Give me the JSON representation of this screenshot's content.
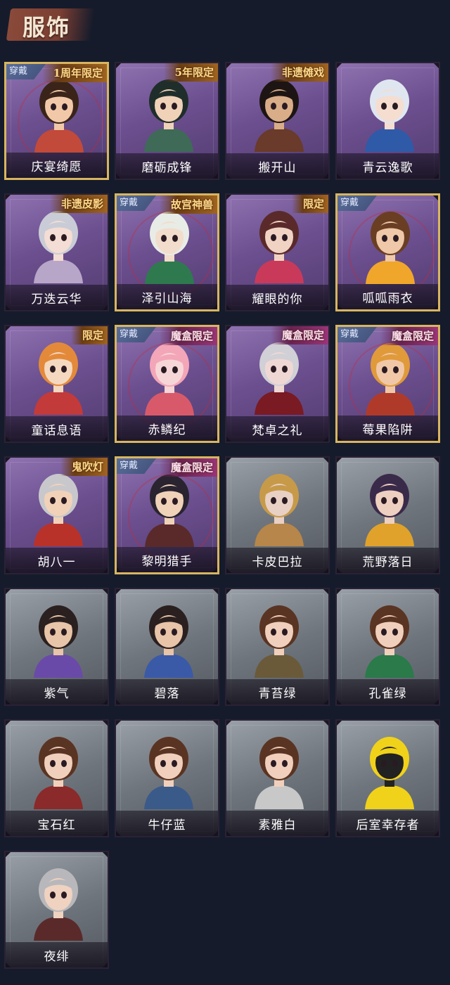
{
  "header": {
    "title": "服饰"
  },
  "equip_text": "穿戴",
  "colors": {
    "purple_card": "#6c4f8f",
    "gray_card": "#6f757d",
    "background": "#151b2b",
    "gold_border": "#d8b560"
  },
  "items": [
    {
      "name": "庆宴绮愿",
      "tag": "1周年限定",
      "equipped": true,
      "style": "purple",
      "skin": "#f2c9a8",
      "hair": "#3a241a",
      "outfit": "#c24a3a"
    },
    {
      "name": "磨砺成锋",
      "tag": "5年限定",
      "equipped": false,
      "style": "purple",
      "skin": "#f0d2b8",
      "hair": "#1f2e2a",
      "outfit": "#3f6a58"
    },
    {
      "name": "搬开山",
      "tag": "非遗傩戏",
      "equipped": false,
      "style": "purple",
      "skin": "#d9ad88",
      "hair": "#1d1513",
      "outfit": "#6a3a2a"
    },
    {
      "name": "青云逸歌",
      "tag": "",
      "equipped": false,
      "style": "purple",
      "skin": "#f5ddd0",
      "hair": "#dfe6f0",
      "outfit": "#2f5aa8"
    },
    {
      "name": "万迭云华",
      "tag": "非遗皮影",
      "equipped": false,
      "style": "purple",
      "skin": "#f3ddd4",
      "hair": "#c9ccd6",
      "outfit": "#b8a6c8"
    },
    {
      "name": "泽引山海",
      "tag": "故宫神兽",
      "equipped": true,
      "style": "purple",
      "skin": "#f2dccb",
      "hair": "#e8ece6",
      "outfit": "#2e7a4e"
    },
    {
      "name": "耀眼的你",
      "tag": "限定",
      "equipped": false,
      "style": "purple",
      "skin": "#f1d3c4",
      "hair": "#5a2a2a",
      "outfit": "#c93a5a"
    },
    {
      "name": "呱呱雨衣",
      "tag": "",
      "equipped": true,
      "style": "purple",
      "skin": "#eec8a8",
      "hair": "#6a3e22",
      "outfit": "#f0a62a"
    },
    {
      "name": "童话息语",
      "tag": "限定",
      "equipped": false,
      "style": "purple",
      "skin": "#f5d8c0",
      "hair": "#e38a3a",
      "outfit": "#c23a3a"
    },
    {
      "name": "赤鳞纪",
      "tag": "魔盒限定",
      "equipped": true,
      "style": "purple",
      "skin": "#f6d6d6",
      "hair": "#f3a6b8",
      "outfit": "#d85a6a"
    },
    {
      "name": "梵卓之礼",
      "tag": "魔盒限定",
      "equipped": false,
      "style": "purple",
      "skin": "#efd8d4",
      "hair": "#d0d0d6",
      "outfit": "#7a1a22"
    },
    {
      "name": "莓果陷阱",
      "tag": "魔盒限定",
      "equipped": true,
      "style": "purple",
      "skin": "#f0c8a8",
      "hair": "#e09a3a",
      "outfit": "#b03a2a"
    },
    {
      "name": "胡八一",
      "tag": "鬼吹灯",
      "equipped": false,
      "style": "purple",
      "skin": "#f1d2b8",
      "hair": "#c8c8cc",
      "outfit": "#b8322a"
    },
    {
      "name": "黎明猎手",
      "tag": "魔盒限定",
      "equipped": true,
      "style": "purple",
      "skin": "#f0d2b8",
      "hair": "#2a2430",
      "outfit": "#5a2a2a"
    },
    {
      "name": "卡皮巴拉",
      "tag": "",
      "equipped": false,
      "style": "gray",
      "skin": "#e8d0c4",
      "hair": "#c79a4a",
      "outfit": "#b6864a"
    },
    {
      "name": "荒野落日",
      "tag": "",
      "equipped": false,
      "style": "gray",
      "skin": "#eed0c0",
      "hair": "#3a2a4a",
      "outfit": "#e0a22a"
    },
    {
      "name": "紫气",
      "tag": "",
      "equipped": false,
      "style": "gray",
      "skin": "#e8c4a8",
      "hair": "#2a2020",
      "outfit": "#6a4aa8"
    },
    {
      "name": "碧落",
      "tag": "",
      "equipped": false,
      "style": "gray",
      "skin": "#e8c4a8",
      "hair": "#2a2020",
      "outfit": "#3a5aa8"
    },
    {
      "name": "青苔绿",
      "tag": "",
      "equipped": false,
      "style": "gray",
      "skin": "#f0d0bc",
      "hair": "#5a3422",
      "outfit": "#6a5a3a"
    },
    {
      "name": "孔雀绿",
      "tag": "",
      "equipped": false,
      "style": "gray",
      "skin": "#f0d0bc",
      "hair": "#5a3422",
      "outfit": "#2a7a4a"
    },
    {
      "name": "宝石红",
      "tag": "",
      "equipped": false,
      "style": "gray",
      "skin": "#f0d0bc",
      "hair": "#5a3422",
      "outfit": "#8a2a2a"
    },
    {
      "name": "牛仔蓝",
      "tag": "",
      "equipped": false,
      "style": "gray",
      "skin": "#f0d0bc",
      "hair": "#5a3422",
      "outfit": "#3a5a8a"
    },
    {
      "name": "素雅白",
      "tag": "",
      "equipped": false,
      "style": "gray",
      "skin": "#f0d0bc",
      "hair": "#5a3422",
      "outfit": "#c8c8c8"
    },
    {
      "name": "后室幸存者",
      "tag": "",
      "equipped": false,
      "style": "gray",
      "skin": "#222222",
      "hair": "#f0d21a",
      "outfit": "#f0d21a"
    },
    {
      "name": "夜绯",
      "tag": "",
      "equipped": false,
      "style": "gray",
      "skin": "#efd2c0",
      "hair": "#b8b8bc",
      "outfit": "#5a2a2a"
    }
  ]
}
